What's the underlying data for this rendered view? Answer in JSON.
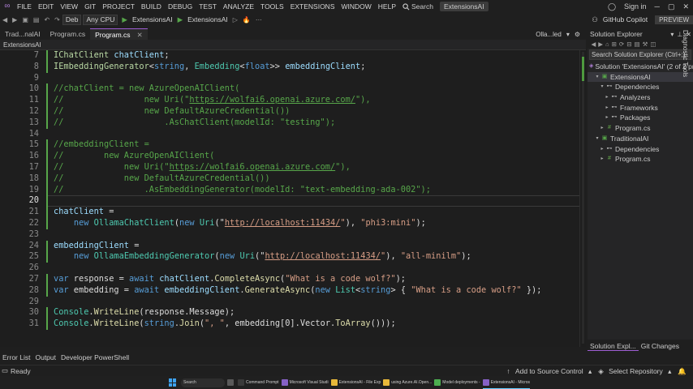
{
  "menu": {
    "items": [
      "FILE",
      "EDIT",
      "VIEW",
      "GIT",
      "PROJECT",
      "BUILD",
      "DEBUG",
      "TEST",
      "ANALYZE",
      "TOOLS",
      "EXTENSIONS",
      "WINDOW",
      "HELP"
    ],
    "search_label": "Search",
    "solution_badge": "ExtensionsAI",
    "sign_in": "Sign in"
  },
  "toolbar": {
    "config": "Deb",
    "platform": "Any CPU",
    "target_project": "ExtensionsAI",
    "run_target": "ExtensionsAI",
    "copilot": "GitHub Copilot",
    "preview": "PREVIEW"
  },
  "tabs": {
    "items": [
      {
        "label": "Trad...nalAI",
        "active": false
      },
      {
        "label": "Program.cs",
        "active": false
      },
      {
        "label": "Program.cs",
        "active": true
      }
    ],
    "overflow": "Olla...led"
  },
  "navbar": {
    "breadcrumb": "ExtensionsAI"
  },
  "editor": {
    "current_line": 20,
    "lines": [
      {
        "n": "7",
        "changed": true,
        "tokens": [
          [
            "iface",
            "IChatClient"
          ],
          [
            "p",
            " "
          ],
          [
            "fld",
            "chatClient"
          ],
          [
            "p",
            ";"
          ]
        ]
      },
      {
        "n": "8",
        "changed": true,
        "tokens": [
          [
            "iface",
            "IEmbeddingGenerator"
          ],
          [
            "p",
            "<"
          ],
          [
            "kw",
            "string"
          ],
          [
            "p",
            ", "
          ],
          [
            "ty",
            "Embedding"
          ],
          [
            "p",
            "<"
          ],
          [
            "kw",
            "float"
          ],
          [
            "p",
            ">> "
          ],
          [
            "fld",
            "embeddingClient"
          ],
          [
            "p",
            ";"
          ]
        ]
      },
      {
        "n": "9",
        "changed": false,
        "tokens": []
      },
      {
        "n": "10",
        "changed": true,
        "tokens": [
          [
            "cmt",
            "//chatClient = new AzureOpenAIClient("
          ]
        ]
      },
      {
        "n": "11",
        "changed": true,
        "tokens": [
          [
            "cmt",
            "//                new Uri(\""
          ],
          [
            "curl",
            "https://wolfai6.openai.azure.com/"
          ],
          [
            "cmt",
            "\"),"
          ]
        ]
      },
      {
        "n": "12",
        "changed": true,
        "tokens": [
          [
            "cmt",
            "//                new DefaultAzureCredential())"
          ]
        ]
      },
      {
        "n": "13",
        "changed": true,
        "tokens": [
          [
            "cmt",
            "//                    .AsChatClient(modelId: \"testing\");"
          ]
        ]
      },
      {
        "n": "14",
        "changed": false,
        "tokens": []
      },
      {
        "n": "15",
        "changed": true,
        "tokens": [
          [
            "cmt",
            "//embeddingClient ="
          ]
        ]
      },
      {
        "n": "16",
        "changed": true,
        "tokens": [
          [
            "cmt",
            "//        new AzureOpenAIClient("
          ]
        ]
      },
      {
        "n": "17",
        "changed": true,
        "tokens": [
          [
            "cmt",
            "//            new Uri(\""
          ],
          [
            "curl",
            "https://wolfai6.openai.azure.com/"
          ],
          [
            "cmt",
            "\"),"
          ]
        ]
      },
      {
        "n": "18",
        "changed": true,
        "tokens": [
          [
            "cmt",
            "//            new DefaultAzureCredential())"
          ]
        ]
      },
      {
        "n": "19",
        "changed": true,
        "tokens": [
          [
            "cmt",
            "//                .AsEmbeddingGenerator(modelId: \"text-embedding-ada-002\");"
          ]
        ]
      },
      {
        "n": "20",
        "changed": true,
        "tokens": []
      },
      {
        "n": "21",
        "changed": true,
        "tokens": [
          [
            "fld",
            "chatClient"
          ],
          [
            "p",
            " ="
          ]
        ]
      },
      {
        "n": "22",
        "changed": true,
        "tokens": [
          [
            "p",
            "    "
          ],
          [
            "kw",
            "new"
          ],
          [
            "p",
            " "
          ],
          [
            "ty",
            "OllamaChatClient"
          ],
          [
            "p",
            "("
          ],
          [
            "kw",
            "new"
          ],
          [
            "p",
            " "
          ],
          [
            "ty",
            "Uri"
          ],
          [
            "p",
            "(\""
          ],
          [
            "url",
            "http://localhost:11434/"
          ],
          [
            "str",
            "\""
          ],
          [
            "p",
            "), "
          ],
          [
            "str",
            "\"phi3:mini\""
          ],
          [
            "p",
            ");"
          ]
        ]
      },
      {
        "n": "23",
        "changed": false,
        "tokens": []
      },
      {
        "n": "24",
        "changed": true,
        "tokens": [
          [
            "fld",
            "embeddingClient"
          ],
          [
            "p",
            " ="
          ]
        ]
      },
      {
        "n": "25",
        "changed": true,
        "tokens": [
          [
            "p",
            "    "
          ],
          [
            "kw",
            "new"
          ],
          [
            "p",
            " "
          ],
          [
            "ty",
            "OllamaEmbeddingGenerator"
          ],
          [
            "p",
            "("
          ],
          [
            "kw",
            "new"
          ],
          [
            "p",
            " "
          ],
          [
            "ty",
            "Uri"
          ],
          [
            "p",
            "(\""
          ],
          [
            "url",
            "http://localhost:11434/"
          ],
          [
            "str",
            "\""
          ],
          [
            "p",
            "), "
          ],
          [
            "str",
            "\"all-minilm\""
          ],
          [
            "p",
            ");"
          ]
        ]
      },
      {
        "n": "26",
        "changed": false,
        "tokens": []
      },
      {
        "n": "27",
        "changed": true,
        "tokens": [
          [
            "kw",
            "var"
          ],
          [
            "p",
            " response = "
          ],
          [
            "kw",
            "await"
          ],
          [
            "p",
            " "
          ],
          [
            "fld",
            "chatClient"
          ],
          [
            "p",
            "."
          ],
          [
            "mth",
            "CompleteAsync"
          ],
          [
            "p",
            "("
          ],
          [
            "str",
            "\"What is a code wolf?\""
          ],
          [
            "p",
            ");"
          ]
        ]
      },
      {
        "n": "28",
        "changed": true,
        "tokens": [
          [
            "kw",
            "var"
          ],
          [
            "p",
            " embedding = "
          ],
          [
            "kw",
            "await"
          ],
          [
            "p",
            " "
          ],
          [
            "fld",
            "embeddingClient"
          ],
          [
            "p",
            "."
          ],
          [
            "mth",
            "GenerateAsync"
          ],
          [
            "p",
            "("
          ],
          [
            "kw",
            "new"
          ],
          [
            "p",
            " "
          ],
          [
            "ty",
            "List"
          ],
          [
            "p",
            "<"
          ],
          [
            "kw",
            "string"
          ],
          [
            "p",
            "> { "
          ],
          [
            "str",
            "\"What is a code wolf?\""
          ],
          [
            "p",
            " });"
          ]
        ]
      },
      {
        "n": "29",
        "changed": false,
        "tokens": []
      },
      {
        "n": "30",
        "changed": true,
        "tokens": [
          [
            "ty",
            "Console"
          ],
          [
            "p",
            "."
          ],
          [
            "mth",
            "WriteLine"
          ],
          [
            "p",
            "(response.Message);"
          ]
        ]
      },
      {
        "n": "31",
        "changed": true,
        "tokens": [
          [
            "ty",
            "Console"
          ],
          [
            "p",
            "."
          ],
          [
            "mth",
            "WriteLine"
          ],
          [
            "p",
            "("
          ],
          [
            "kw",
            "string"
          ],
          [
            "p",
            "."
          ],
          [
            "mth",
            "Join"
          ],
          [
            "p",
            "("
          ],
          [
            "str",
            "\", \""
          ],
          [
            "p",
            ", embedding[0].Vector."
          ],
          [
            "mth",
            "ToArray"
          ],
          [
            "p",
            "()));"
          ]
        ]
      }
    ]
  },
  "panel_tabs": [
    "Error List",
    "Output",
    "Developer PowerShell"
  ],
  "solution_explorer": {
    "title": "Solution Explorer",
    "search_placeholder": "Search Solution Explorer (Ctrl+;)",
    "tree": [
      {
        "label": "Solution 'ExtensionsAI' (2 of 2 projects)",
        "depth": 0,
        "icon": "sln",
        "arrow": "",
        "selected": false
      },
      {
        "label": "ExtensionsAI",
        "depth": 1,
        "icon": "proj",
        "arrow": "▾",
        "selected": true
      },
      {
        "label": "Dependencies",
        "depth": 2,
        "icon": "deps",
        "arrow": "▾",
        "selected": false
      },
      {
        "label": "Analyzers",
        "depth": 3,
        "icon": "deps",
        "arrow": "▸",
        "selected": false
      },
      {
        "label": "Frameworks",
        "depth": 3,
        "icon": "deps",
        "arrow": "▸",
        "selected": false
      },
      {
        "label": "Packages",
        "depth": 3,
        "icon": "deps",
        "arrow": "▸",
        "selected": false
      },
      {
        "label": "Program.cs",
        "depth": 2,
        "icon": "cs",
        "arrow": "▸",
        "selected": false
      },
      {
        "label": "TraditionalAI",
        "depth": 1,
        "icon": "proj",
        "arrow": "▾",
        "selected": false
      },
      {
        "label": "Dependencies",
        "depth": 2,
        "icon": "deps",
        "arrow": "▸",
        "selected": false
      },
      {
        "label": "Program.cs",
        "depth": 2,
        "icon": "cs",
        "arrow": "▸",
        "selected": false
      }
    ],
    "bottom_tabs": [
      "Solution Expl...",
      "Git Changes"
    ]
  },
  "diagnostic_tools": "Diagnostic Tools",
  "status": {
    "ready": "Ready",
    "source_control": "Add to Source Control",
    "repository": "Select Repository"
  },
  "taskbar": {
    "search": "Search",
    "apps": [
      {
        "label": "",
        "color": "#5a5a5a"
      },
      {
        "label": "Command Prompt",
        "color": "#3a3a3a"
      },
      {
        "label": "Microsoft Visual Studi",
        "color": "#8661c5"
      },
      {
        "label": "ExtensionsAI - File Exp",
        "color": "#e8b83a"
      },
      {
        "label": "using Azure.AI.Open...",
        "color": "#e8b83a"
      },
      {
        "label": "Model deployments -",
        "color": "#4caf50"
      },
      {
        "label": "ExtensionsAI - Micros",
        "color": "#8661c5"
      }
    ]
  }
}
